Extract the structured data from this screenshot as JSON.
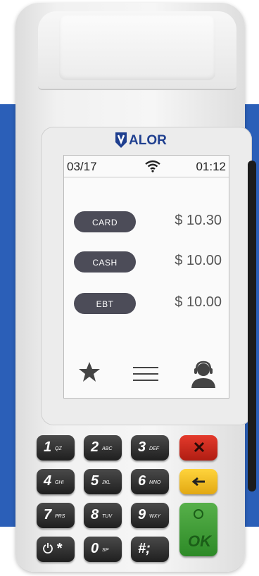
{
  "brand": {
    "logo": "VALOR",
    "color": "#1f3f8f"
  },
  "status_bar": {
    "date": "03/17",
    "time": "01:12",
    "wifi_icon": "wifi-icon"
  },
  "payments": [
    {
      "label": "CARD",
      "amount": "$ 10.30"
    },
    {
      "label": "CASH",
      "amount": "$ 10.00"
    },
    {
      "label": "EBT",
      "amount": "$ 10.00"
    }
  ],
  "toolbar": {
    "favorites_icon": "star-icon",
    "menu_icon": "menu-icon",
    "support_icon": "support-agent-icon"
  },
  "keypad": {
    "keys": [
      {
        "digit": "1",
        "sub": "QZ"
      },
      {
        "digit": "2",
        "sub": "ABC"
      },
      {
        "digit": "3",
        "sub": "DEF"
      },
      {
        "digit": "4",
        "sub": "GHI"
      },
      {
        "digit": "5",
        "sub": "JKL"
      },
      {
        "digit": "6",
        "sub": "MNO"
      },
      {
        "digit": "7",
        "sub": "PRS"
      },
      {
        "digit": "8",
        "sub": "TUV"
      },
      {
        "digit": "9",
        "sub": "WXY"
      },
      {
        "digit": "*",
        "sub": ""
      },
      {
        "digit": "0",
        "sub": "SP"
      },
      {
        "digit": "#;",
        "sub": ""
      }
    ],
    "ok_label": "OK",
    "colors": {
      "cancel": "#d42b1e",
      "clear": "#f5c21f",
      "enter": "#3f9e36"
    }
  }
}
